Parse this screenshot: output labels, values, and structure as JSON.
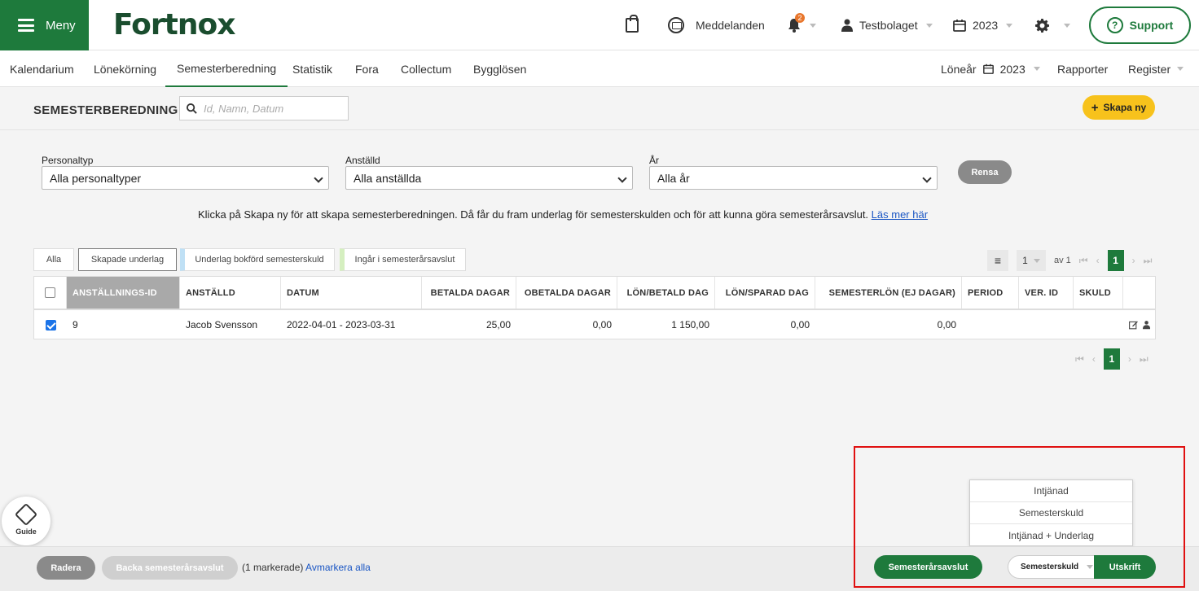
{
  "topbar": {
    "menu_label": "Meny",
    "logo": "Fortnox",
    "messages": "Meddelanden",
    "notification_count": "2",
    "company": "Testbolaget",
    "year": "2023",
    "support": "Support"
  },
  "nav": {
    "items": [
      "Kalendarium",
      "Lönekörning",
      "Semesterberedning",
      "Statistik",
      "Fora",
      "Collectum",
      "Bygglösen"
    ],
    "active": "Semesterberedning",
    "loneyear_label": "Löneår",
    "loneyear_value": "2023",
    "reports": "Rapporter",
    "register": "Register"
  },
  "title": {
    "page_title": "SEMESTERBEREDNING",
    "search_placeholder": "Id, Namn, Datum",
    "create_button": "Skapa ny"
  },
  "filters": {
    "personaltyp_label": "Personaltyp",
    "personaltyp_value": "Alla personaltyper",
    "anstalld_label": "Anställd",
    "anstalld_value": "Alla anställda",
    "ar_label": "År",
    "ar_value": "Alla år",
    "clear_button": "Rensa"
  },
  "info": {
    "text": "Klicka på Skapa ny för att skapa semesterberedningen. Då får du fram underlag för semesterskulden och för att kunna göra semesterårsavslut.",
    "link": "Läs mer här"
  },
  "segments": [
    "Alla",
    "Skapade underlag",
    "Underlag bokförd semesterskuld",
    "Ingår i semesterårsavslut"
  ],
  "pagination": {
    "page_size": "1",
    "of_label": "av 1",
    "current": "1"
  },
  "table": {
    "columns": [
      "ANSTÄLLNINGS-ID",
      "ANSTÄLLD",
      "DATUM",
      "BETALDA DAGAR",
      "OBETALDA DAGAR",
      "LÖN/BETALD DAG",
      "LÖN/SPARAD DAG",
      "SEMESTERLÖN (EJ DAGAR)",
      "PERIOD",
      "VER. ID",
      "SKULD"
    ],
    "rows": [
      {
        "id": "9",
        "name": "Jacob Svensson",
        "date": "2022-04-01 - 2023-03-31",
        "paid_days": "25,00",
        "unpaid_days": "0,00",
        "salary_paid_day": "1 150,00",
        "salary_saved_day": "0,00",
        "vacation_pay": "0,00",
        "period": "",
        "ver_id": "",
        "debt": ""
      }
    ]
  },
  "guide": {
    "label": "Guide"
  },
  "dropdown": {
    "items": [
      "Intjänad",
      "Semesterskuld",
      "Intjänad + Underlag"
    ]
  },
  "footer": {
    "delete_button": "Radera",
    "undo_button": "Backa semesterårsavslut",
    "marked_text": "(1 markerade)",
    "unmark_link": "Avmarkera alla",
    "close_year_button": "Semesterårsavslut",
    "print_select": "Semesterskuld",
    "print_button": "Utskrift"
  },
  "colors": {
    "brand_green": "#1e7a3c",
    "accent_yellow": "#f7c21c",
    "highlight_red": "#e01010"
  }
}
